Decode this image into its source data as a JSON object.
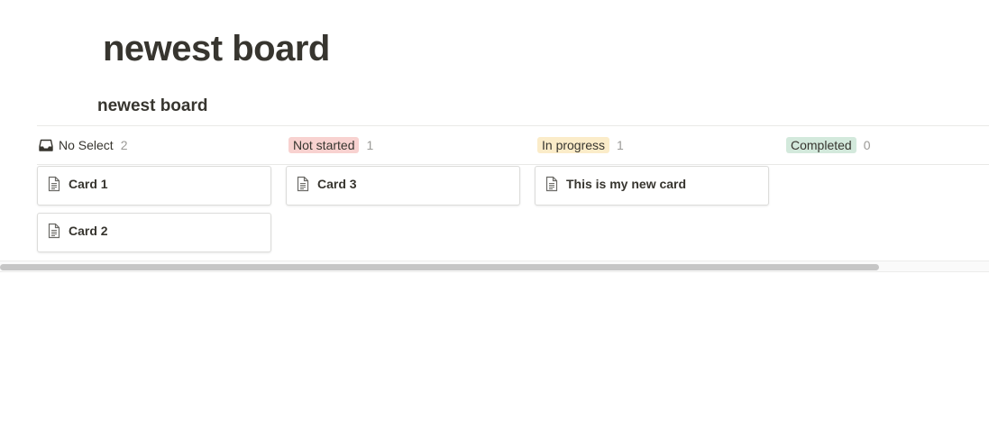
{
  "page": {
    "title": "newest board"
  },
  "view": {
    "title": "newest board"
  },
  "groups": [
    {
      "label": "No Select",
      "count": "2",
      "icon": "inbox-icon",
      "cards": [
        {
          "title": "Card 1",
          "icon": "page-icon"
        },
        {
          "title": "Card 2",
          "icon": "page-icon"
        }
      ]
    },
    {
      "label": "Not started",
      "count": "1",
      "color": "#f8d2d0",
      "cards": [
        {
          "title": "Card 3",
          "icon": "page-icon"
        }
      ]
    },
    {
      "label": "In progress",
      "count": "1",
      "color": "#fbecc9",
      "cards": [
        {
          "title": "This is my new card",
          "icon": "page-icon"
        }
      ]
    },
    {
      "label": "Completed",
      "count": "0",
      "color": "#d3e9dc",
      "cards": []
    }
  ]
}
